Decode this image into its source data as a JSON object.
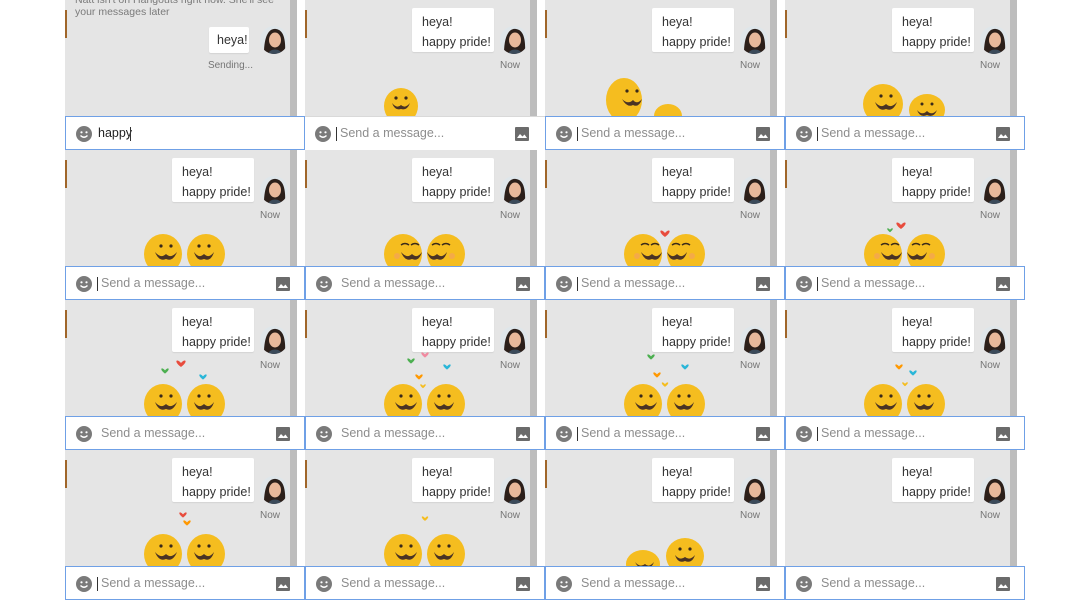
{
  "conversation": {
    "notice": "Natt isn't on Hangouts right now. She'll see your messages later",
    "short_message": "heya!",
    "message_line1": "heya!",
    "message_line2": "happy pride!",
    "status_sending": "Sending...",
    "status_now": "Now"
  },
  "composer": {
    "typed_value": "happy",
    "placeholder": "Send a message..."
  },
  "icons": {
    "emoji": "smiley-face-icon",
    "image": "image-attach-icon",
    "avatar": "contact-avatar",
    "sticker": "mustache-duck-sticker"
  },
  "colors": {
    "chat_bg": "#e5e5e5",
    "focus_border": "#6fa0e6",
    "duck_yellow": "#f5bd1f",
    "heart_red": "#e84c3d",
    "heart_green": "#4caf50",
    "heart_blue": "#29b6d8",
    "heart_orange": "#ff9800"
  }
}
